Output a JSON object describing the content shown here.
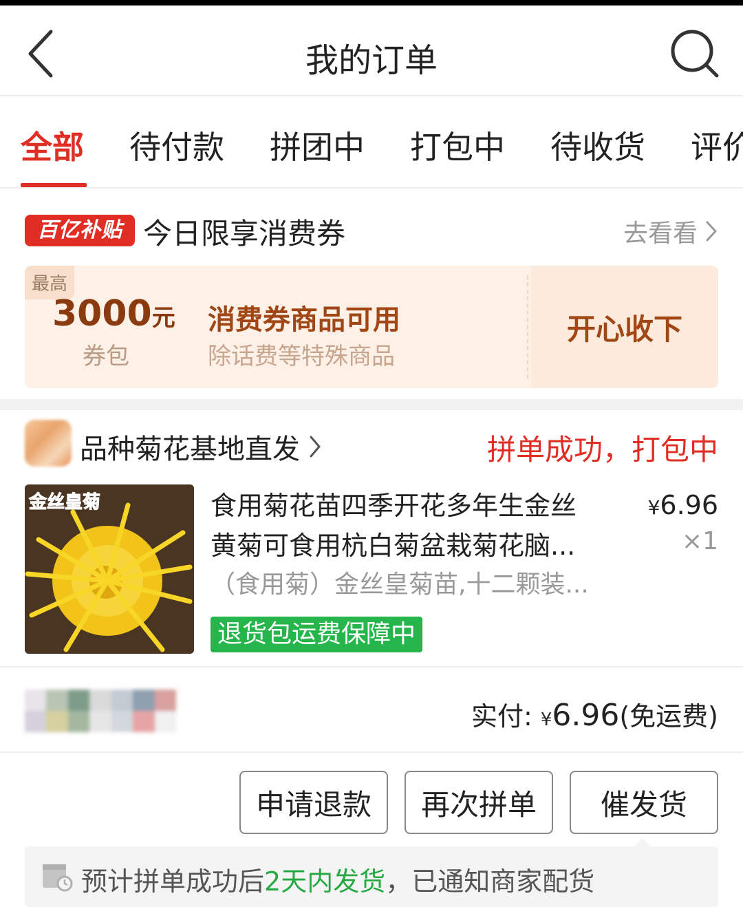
{
  "header": {
    "title": "我的订单"
  },
  "tabs": [
    {
      "label": "全部",
      "active": true
    },
    {
      "label": "待付款"
    },
    {
      "label": "拼团中"
    },
    {
      "label": "打包中"
    },
    {
      "label": "待收货"
    },
    {
      "label": "评价"
    }
  ],
  "coupon": {
    "badge": "百亿补贴",
    "title": "今日限享消费券",
    "see_more": "去看看",
    "max_label": "最高",
    "amount": "3000",
    "amount_unit": "元",
    "pack_label": "券包",
    "usable": "消费券商品可用",
    "except": "除话费等特殊商品",
    "accept_button": "开心收下"
  },
  "order": {
    "shop_name": "品种菊花基地直发",
    "status": "拼单成功，打包中",
    "product": {
      "image_caption": "金丝皇菊",
      "title_line1": "食用菊花苗四季开花多年生金丝",
      "title_line2": "黄菊可食用杭白菊盆栽菊花脑...",
      "spec": "（食用菊）金丝皇菊苗,十二颗装...",
      "price_symbol": "¥",
      "price": "6.96",
      "quantity": "×1",
      "guarantee": "退货包运费保障中"
    },
    "payment": {
      "label": "实付: ",
      "symbol": "¥",
      "amount": "6.96",
      "shipping_note": "(免运费)"
    },
    "actions": {
      "refund": "申请退款",
      "reorder": "再次拼单",
      "urge": "催发货"
    },
    "notice": {
      "prefix": "预计拼单成功后",
      "highlight": "2天内发货",
      "suffix": "，已通知商家配货"
    }
  },
  "colors": {
    "brand_red": "#e02e24",
    "success_green": "#26b54a",
    "coupon_brown": "#a14615"
  },
  "icons": [
    "back-arrow-icon",
    "search-icon",
    "chevron-right-icon",
    "shipping-clock-icon"
  ]
}
